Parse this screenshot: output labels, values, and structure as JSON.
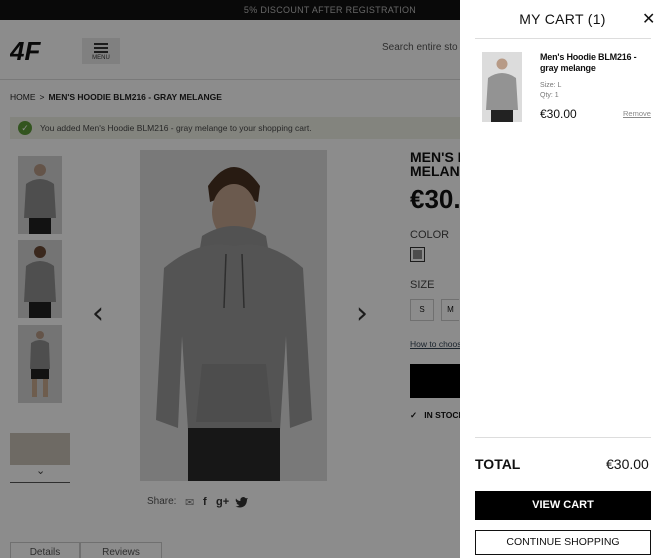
{
  "topbar": {
    "promo": "5% DISCOUNT AFTER REGISTRATION"
  },
  "header": {
    "logo_text": "4F",
    "menu_label": "MENU",
    "search_placeholder": "Search entire sto"
  },
  "breadcrumb": {
    "home": "HOME",
    "separator": ">",
    "current": "MEN'S HOODIE BLM216 - GRAY MELANGE"
  },
  "notice": {
    "icon": "check-icon",
    "message": "You added Men's Hoodie BLM216 - gray melange to your shopping cart."
  },
  "product": {
    "title_line1": "MEN'S H",
    "title_line2": "MELANG",
    "price": "€30.",
    "color_label": "COLOR",
    "size_label": "SIZE",
    "sizes": [
      "S",
      "M"
    ],
    "size_guide": "How to choos",
    "stock": "IN STOCK",
    "share_label": "Share:",
    "share_icons": [
      "email-icon",
      "facebook-icon",
      "google-plus-icon",
      "twitter-icon"
    ],
    "fb_glyph": "f",
    "gplus_glyph": "g+"
  },
  "tabs": [
    "Details",
    "Reviews"
  ],
  "colors": {
    "accent": "#000000",
    "success": "#5d9b3a",
    "overlay": "rgba(0,0,0,0.45)"
  },
  "cart": {
    "title": "MY CART (1)",
    "close_icon": "close-icon",
    "items": [
      {
        "name": "Men's Hoodie BLM216 - gray melange",
        "size": "Size: L",
        "qty": "Qty: 1",
        "price": "€30.00",
        "remove": "Remove"
      }
    ],
    "total_label": "TOTAL",
    "total_value": "€30.00",
    "view_cart": "VIEW CART",
    "continue": "CONTINUE SHOPPING"
  }
}
